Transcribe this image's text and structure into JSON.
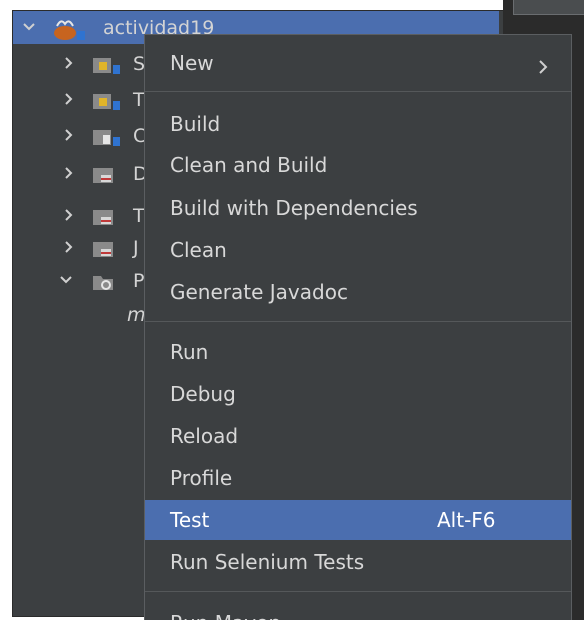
{
  "tree": {
    "root_label": "actividad19",
    "partial_labels": [
      "S",
      "T",
      "C",
      "D",
      "T",
      "J",
      "P"
    ],
    "child_label": "m"
  },
  "menu": {
    "items": [
      {
        "label": "New",
        "submenu": true
      },
      {
        "label": "Build"
      },
      {
        "label": "Clean and Build"
      },
      {
        "label": "Build with Dependencies"
      },
      {
        "label": "Clean"
      },
      {
        "label": "Generate Javadoc"
      },
      {
        "label": "Run"
      },
      {
        "label": "Debug"
      },
      {
        "label": "Reload"
      },
      {
        "label": "Profile"
      },
      {
        "label": "Test",
        "shortcut": "Alt-F6",
        "highlighted": true
      },
      {
        "label": "Run Selenium Tests"
      },
      {
        "label": "Run Maven",
        "submenu": true
      }
    ]
  },
  "colors": {
    "panel_bg": "#3c3f41",
    "selection": "#4b6eaf",
    "text": "#d8d8d8"
  },
  "icons": [
    "chevron-down-icon",
    "chevron-right-icon",
    "maven-project-icon",
    "source-package-icon",
    "test-package-icon",
    "library-folder-icon",
    "submenu-arrow-icon"
  ]
}
